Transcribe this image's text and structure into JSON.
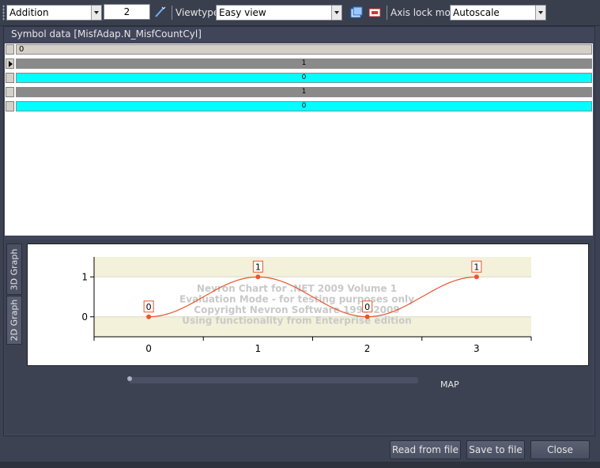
{
  "toolbar": {
    "mode_value": "Addition",
    "count_value": "2",
    "viewtype_label": "Viewtype",
    "viewtype_value": "Easy view",
    "axislock_label": "Axis lock mode",
    "axislock_value": "Autoscale"
  },
  "panel": {
    "title": "Symbol data [MisfAdap.N_MisfCountCyl]"
  },
  "grid": {
    "header_value": "0",
    "rows": [
      {
        "value": "1",
        "color": "#8a8a8a",
        "selected": true
      },
      {
        "value": "0",
        "color": "#00ffff",
        "selected": false
      },
      {
        "value": "1",
        "color": "#8a8a8a",
        "selected": false
      },
      {
        "value": "0",
        "color": "#00ffff",
        "selected": false
      }
    ]
  },
  "tabs": {
    "graph3d": "3D Graph",
    "graph2d": "2D Graph"
  },
  "chart_data": {
    "type": "line",
    "x": [
      0,
      1,
      2,
      3
    ],
    "y": [
      0,
      1,
      0,
      1
    ],
    "data_labels": [
      "0",
      "1",
      "0",
      "1"
    ],
    "xticks": [
      "0",
      "1",
      "2",
      "3"
    ],
    "yticks": [
      "0",
      "1"
    ],
    "xlim": [
      -0.5,
      3.5
    ],
    "ylim": [
      -0.5,
      1.5
    ],
    "series_color": "#e8552d",
    "band_color": "#f3f1d9",
    "watermark": [
      "Nevron Chart for .NET 2009 Volume 1",
      "Evaluation Mode - for testing purposes only",
      "Copyright Nevron Software 1998-2009",
      "Using functionality from Enterprise edition"
    ]
  },
  "slider": {
    "label": "MAP",
    "value": 0
  },
  "buttons": {
    "read": "Read from file",
    "save": "Save to file",
    "close": "Close"
  }
}
